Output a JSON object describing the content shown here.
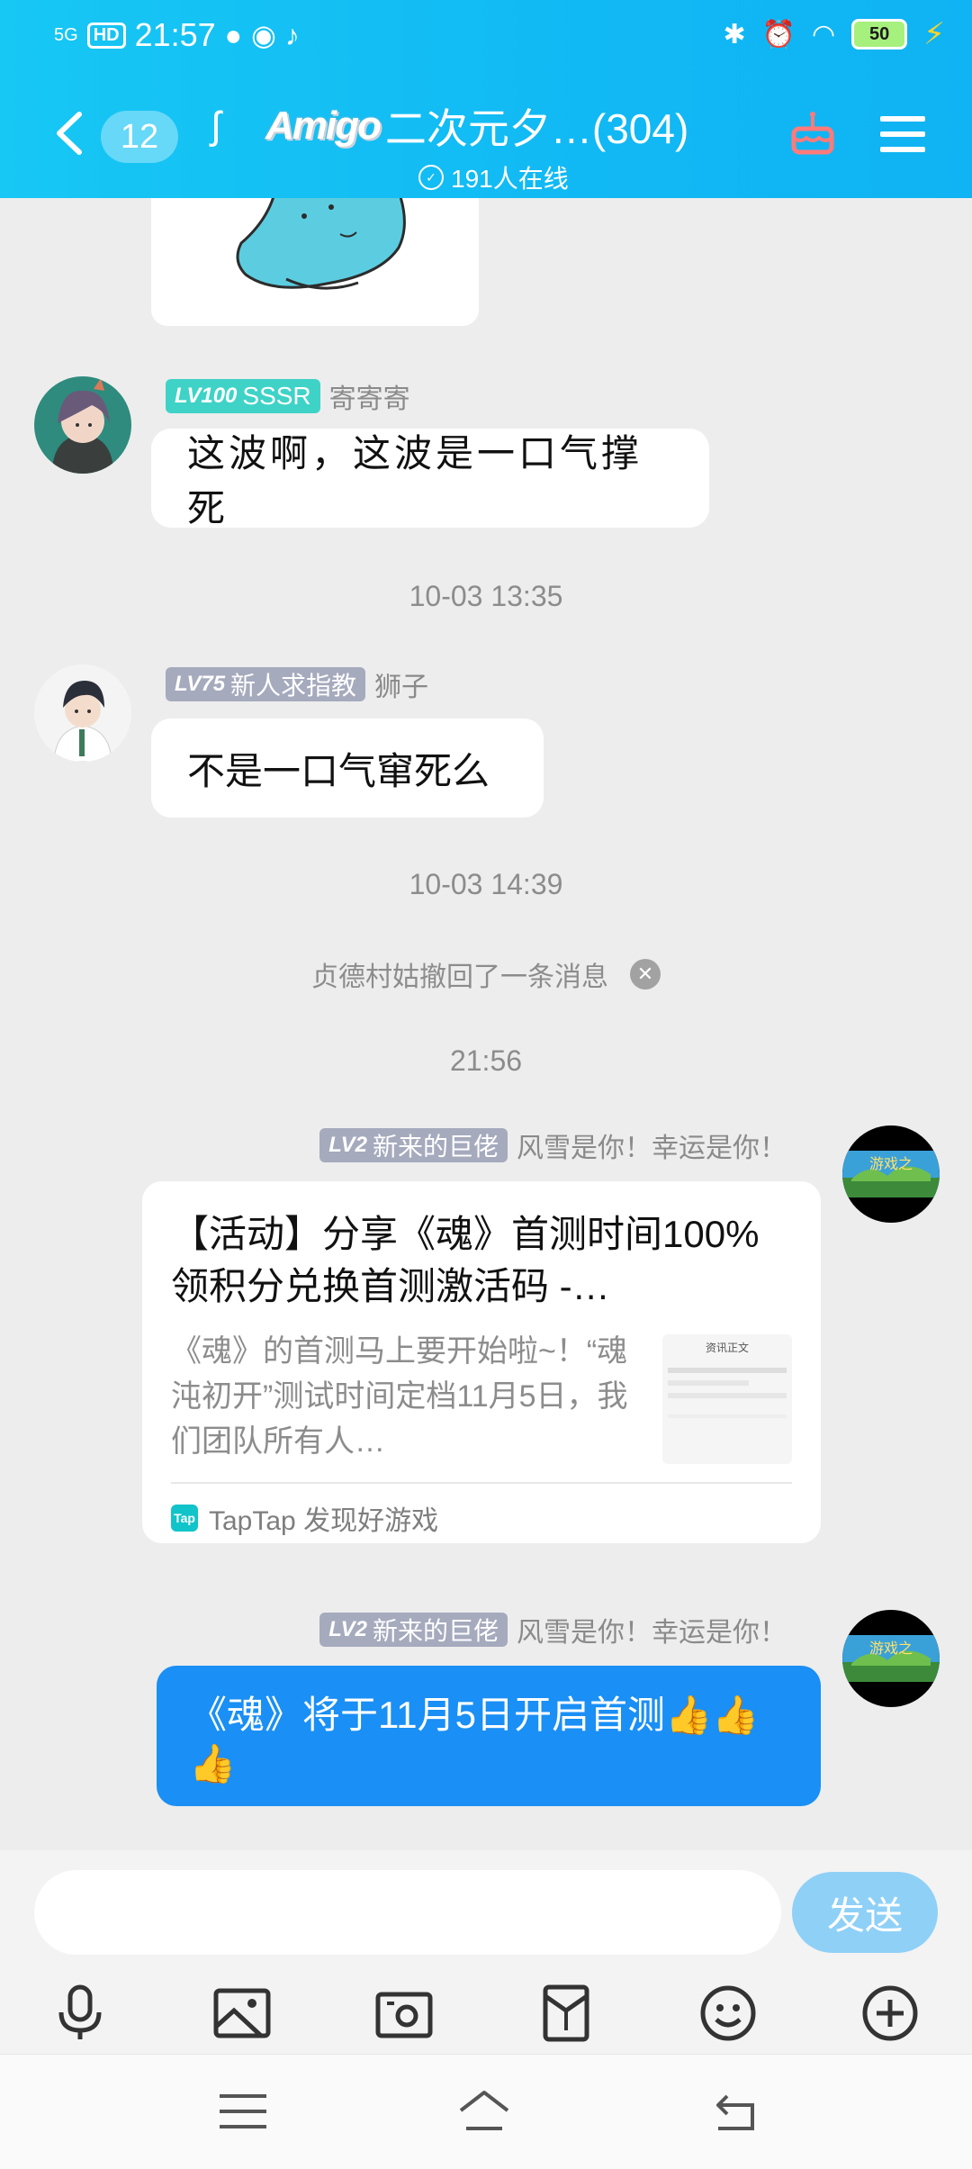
{
  "status_bar": {
    "signal": "5G",
    "hd": "HD",
    "time": "21:57",
    "battery": "50",
    "icons": [
      "wechat-icon",
      "qq-icon",
      "tiktok-icon",
      "bluetooth-icon",
      "alarm-icon",
      "wifi-icon",
      "charging-icon"
    ]
  },
  "header": {
    "unread_count": "12",
    "logo_text": "Amigo",
    "title": "二次元夕…(304)",
    "online": "191人在线"
  },
  "messages": {
    "m1": {
      "level": "LV100",
      "title": "SSSR",
      "name": "寄寄寄",
      "text": "这波啊，这波是一口气撑死"
    },
    "time1": "10-03 13:35",
    "m2": {
      "level": "LV75",
      "title": "新人求指教",
      "name": "狮子",
      "text": "不是一口气窜死么"
    },
    "time2": "10-03 14:39",
    "recall": "贞德村姑撤回了一条消息",
    "time3": "21:56",
    "m3": {
      "level": "LV2",
      "title": "新来的巨佬",
      "name": "风雪是你！幸运是你！",
      "card_title": "【活动】分享《魂》首测时间100%领积分兑换首测激活码 -…",
      "card_desc": "《魂》的首测马上要开始啦~！“魂沌初开”测试时间定档11月5日，我们团队所有人…",
      "card_thumb_title": "资讯正文",
      "card_source": "TapTap 发现好游戏",
      "card_source_logo": "Tap"
    },
    "m4": {
      "level": "LV2",
      "title": "新来的巨佬",
      "name": "风雪是你！幸运是你！",
      "text": "《魂》将于11月5日开启首测👍👍👍"
    }
  },
  "input": {
    "placeholder": "",
    "send_label": "发送"
  },
  "colors": {
    "header": "#11b9f4",
    "sent_bubble": "#1a8ff5",
    "send_button": "#8fd0f7",
    "badge_teal": "#3ed3c6",
    "badge_gray": "#a5aabd"
  }
}
